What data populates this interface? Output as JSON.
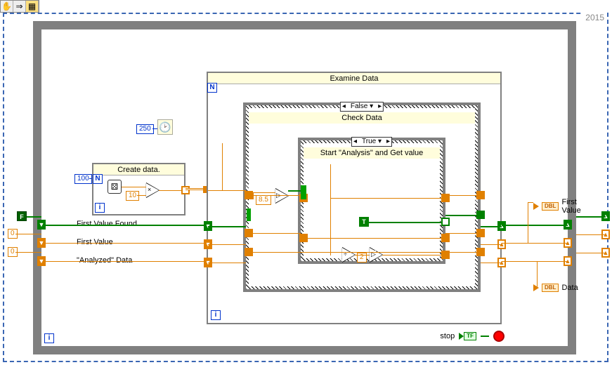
{
  "toolbar": {
    "pan_icon": "✋",
    "arrow_icon": "⇒",
    "highlight_icon": "▦"
  },
  "year": "2015",
  "examine_loop": {
    "title": "Examine Data",
    "n_label": "N"
  },
  "check_case": {
    "title": "Check Data",
    "selector": "False ▾"
  },
  "start_case": {
    "title": "Start \"Analysis\" and Get value",
    "selector": "True ▾"
  },
  "create_loop": {
    "title": "Create data.",
    "n_label": "N",
    "count": "100",
    "mult": "10"
  },
  "wait_ms": "250",
  "compare_const": "8.5",
  "divide_const": "2",
  "labels": {
    "first_value_found": "First Value Found",
    "first_value": "First Value",
    "analyzed_data": "\"Analyzed\" Data"
  },
  "bool_f": "F",
  "bool_t": "T",
  "initial_zero_1": "0",
  "initial_zero_2": "0",
  "indicators": {
    "first_value": "First Value",
    "data": "Data",
    "dbl": "DBL"
  },
  "stop": {
    "label": "stop",
    "tf": "TF"
  },
  "i_label": "i"
}
